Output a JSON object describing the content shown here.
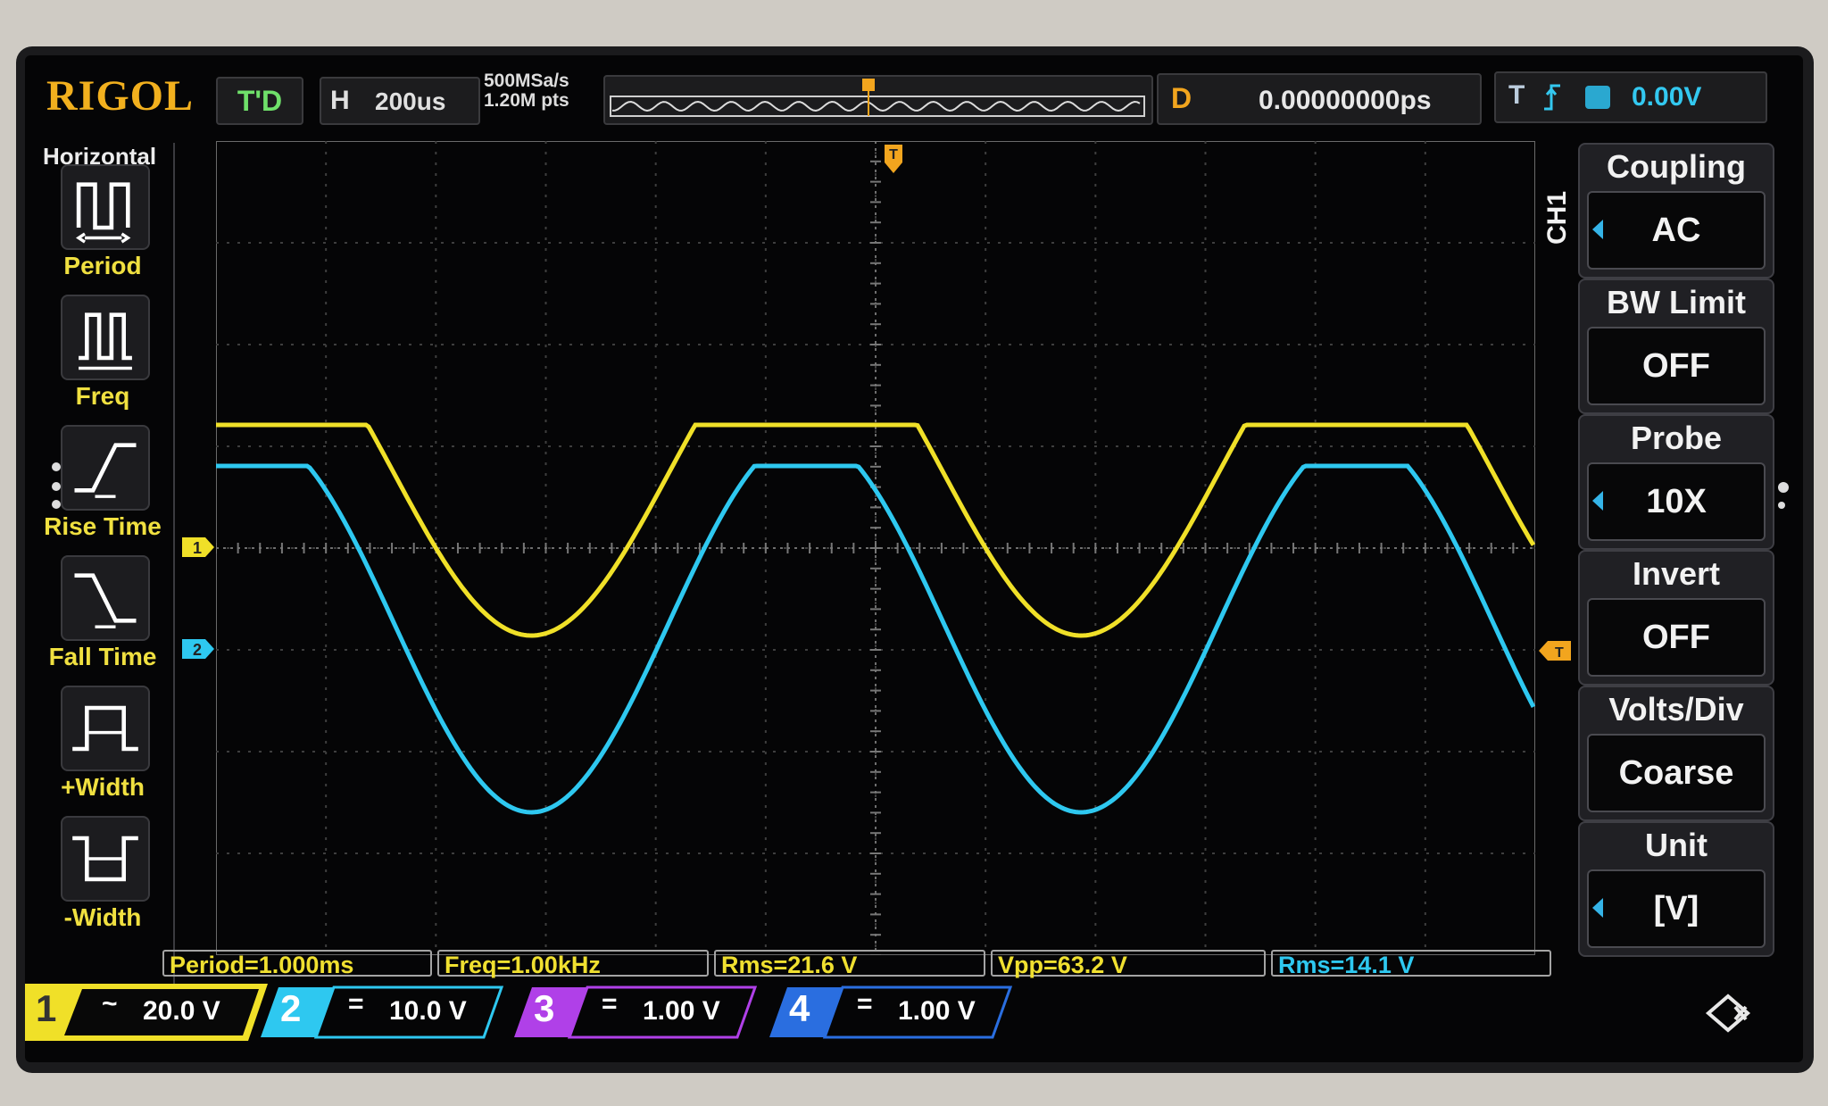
{
  "header": {
    "brand": "RIGOL",
    "run_state": "T'D",
    "horizontal_label": "H",
    "timebase": "200us",
    "sample_rate": "500MSa/s",
    "memory_depth": "1.20M pts",
    "delay_label": "D",
    "delay_value": "0.00000000ps",
    "trigger_label": "T",
    "trigger_level": "0.00V"
  },
  "left_menu": {
    "title": "Horizontal",
    "items": [
      {
        "label": "Period",
        "icon": "period-icon"
      },
      {
        "label": "Freq",
        "icon": "freq-icon"
      },
      {
        "label": "Rise Time",
        "icon": "rise-time-icon"
      },
      {
        "label": "Fall Time",
        "icon": "fall-time-icon"
      },
      {
        "label": "+Width",
        "icon": "positive-width-icon"
      },
      {
        "label": "-Width",
        "icon": "negative-width-icon"
      }
    ]
  },
  "right_menu": {
    "channel_tag": "CH1",
    "items": [
      {
        "title": "Coupling",
        "value": "AC",
        "has_arrow": true
      },
      {
        "title": "BW Limit",
        "value": "OFF",
        "has_arrow": false
      },
      {
        "title": "Probe",
        "value": "10X",
        "has_arrow": true
      },
      {
        "title": "Invert",
        "value": "OFF",
        "has_arrow": false
      },
      {
        "title": "Volts/Div",
        "value": "Coarse",
        "has_arrow": false
      },
      {
        "title": "Unit",
        "value": "[V]",
        "has_arrow": true
      }
    ]
  },
  "measurements": [
    "Period=1.000ms",
    "Freq=1.00kHz",
    "Rms=21.6 V",
    "Vpp=63.2 V",
    "Rms=14.1 V"
  ],
  "channels": [
    {
      "number": "1",
      "coupling": "~",
      "scale": "20.0 V",
      "color": "#f0e028"
    },
    {
      "number": "2",
      "coupling": "=",
      "scale": "10.0 V",
      "color": "#2ec8f0"
    },
    {
      "number": "3",
      "coupling": "=",
      "scale": "1.00 V",
      "color": "#b040e8"
    },
    {
      "number": "4",
      "coupling": "=",
      "scale": "1.00 V",
      "color": "#2a6ee0"
    }
  ],
  "trigger_markers": {
    "top": "T",
    "right": "T"
  },
  "colors": {
    "ch1": "#f0e028",
    "ch2": "#2ec8f0",
    "accent": "#f2a51e"
  }
}
